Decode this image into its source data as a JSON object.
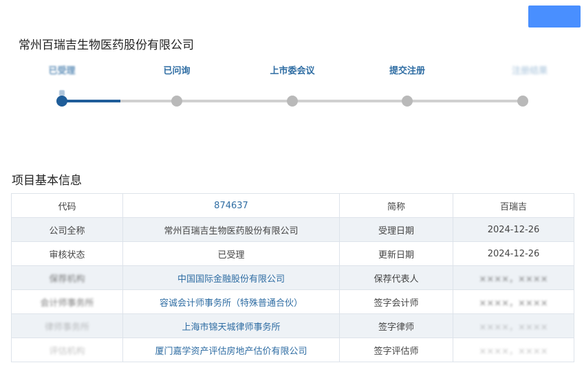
{
  "company_name": "常州百瑞吉生物医药股份有限公司",
  "steps": [
    {
      "label": "已受理",
      "state": "done",
      "obscured": true
    },
    {
      "label": "已问询",
      "state": "pending",
      "obscured": false
    },
    {
      "label": "上市委会议",
      "state": "pending",
      "obscured": false
    },
    {
      "label": "提交注册",
      "state": "pending",
      "obscured": false
    },
    {
      "label": "注册结果",
      "state": "pending",
      "obscured": true
    }
  ],
  "section_title": "项目基本信息",
  "rows": [
    {
      "k1": "代码",
      "v1": "874637",
      "k2": "简称",
      "v2": "百瑞吉"
    },
    {
      "k1": "公司全称",
      "v1": "常州百瑞吉生物医药股份有限公司",
      "k2": "受理日期",
      "v2": "2024-12-26"
    },
    {
      "k1": "审核状态",
      "v1": "已受理",
      "k2": "更新日期",
      "v2": "2024-12-26"
    },
    {
      "k1": "保荐机构",
      "v1": "中国国际金融股份有限公司",
      "k2": "保荐代表人",
      "v2": "××××，××××"
    },
    {
      "k1": "会计师事务所",
      "v1": "容诚会计师事务所（特殊普通合伙）",
      "k2": "签字会计师",
      "v2": "××××，××××"
    },
    {
      "k1": "律师事务所",
      "v1": "上海市锦天城律师事务所",
      "k2": "签字律师",
      "v2": "××××，××××"
    },
    {
      "k1": "评估机构",
      "v1": "厦门嘉学资产评估房地产估价有限公司",
      "k2": "签字评估师",
      "v2": "××××，××××"
    }
  ]
}
